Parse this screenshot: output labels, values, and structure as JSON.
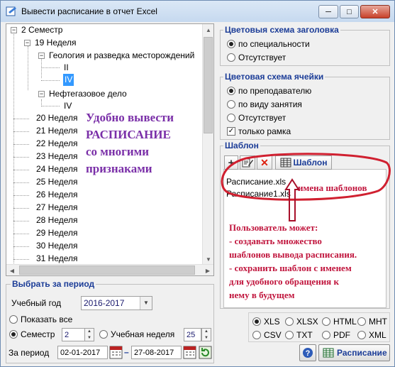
{
  "window": {
    "title": "Вывести расписание в отчет Excel",
    "min": "─",
    "max": "□",
    "close": "✕"
  },
  "tree": {
    "semester": "2 Семестр",
    "week19": "19 Неделя",
    "geology": "Геология и разведка месторождений",
    "ii": "II",
    "iv_sel": "IV",
    "oil": "Нефтегазовое дело",
    "iv": "IV",
    "weeks": [
      "20 Неделя",
      "21 Неделя",
      "22 Неделя",
      "23 Неделя",
      "24 Неделя",
      "25 Неделя",
      "26 Неделя",
      "27 Неделя",
      "28 Неделя",
      "29 Неделя",
      "30 Неделя",
      "31 Неделя"
    ]
  },
  "overlay": {
    "line1": "Удобно вывести",
    "line2": "РАСПИСАНИЕ",
    "line3": "со многими",
    "line4": "признаками"
  },
  "period": {
    "legend": "Выбрать за период",
    "year_label": "Учебный год",
    "year_value": "2016-2017",
    "show_all": "Показать все",
    "semester_label": "Семестр",
    "semester_value": "2",
    "week_label": "Учебная неделя",
    "week_value": "25",
    "range_label": "За период",
    "date_from": "02-01-2017",
    "dash": "–",
    "date_to": "27-08-2017"
  },
  "header_scheme": {
    "legend": "Цветовыя схема заголовка",
    "opt1": "по специальности",
    "opt2": "Отсутствует"
  },
  "cell_scheme": {
    "legend": "Цветовая схема ячейки",
    "opt1": "по преподавателю",
    "opt2": "по виду занятия",
    "opt3": "Отсутствует",
    "opt4": "только рамка"
  },
  "template": {
    "legend": "Шаблон",
    "btn_label": "Шаблон",
    "files": [
      "Расписание.xls",
      "Расписание1.xls"
    ],
    "annotation": "имена шаблонов",
    "note": [
      "Пользователь может:",
      "- создавать множество",
      "шаблонов вывода расписания.",
      "- сохранить шаблон с именем",
      "для удобного обращения к",
      "нему в будущем"
    ]
  },
  "formats": [
    "XLS",
    "XLSX",
    "HTML",
    "MHT",
    "CSV",
    "TXT",
    "PDF",
    "XML"
  ],
  "footer": {
    "run_label": "Расписание"
  },
  "colors": {
    "accent": "#1b3c97",
    "annotation": "#c0143c",
    "overlay": "#7a2fa8"
  }
}
